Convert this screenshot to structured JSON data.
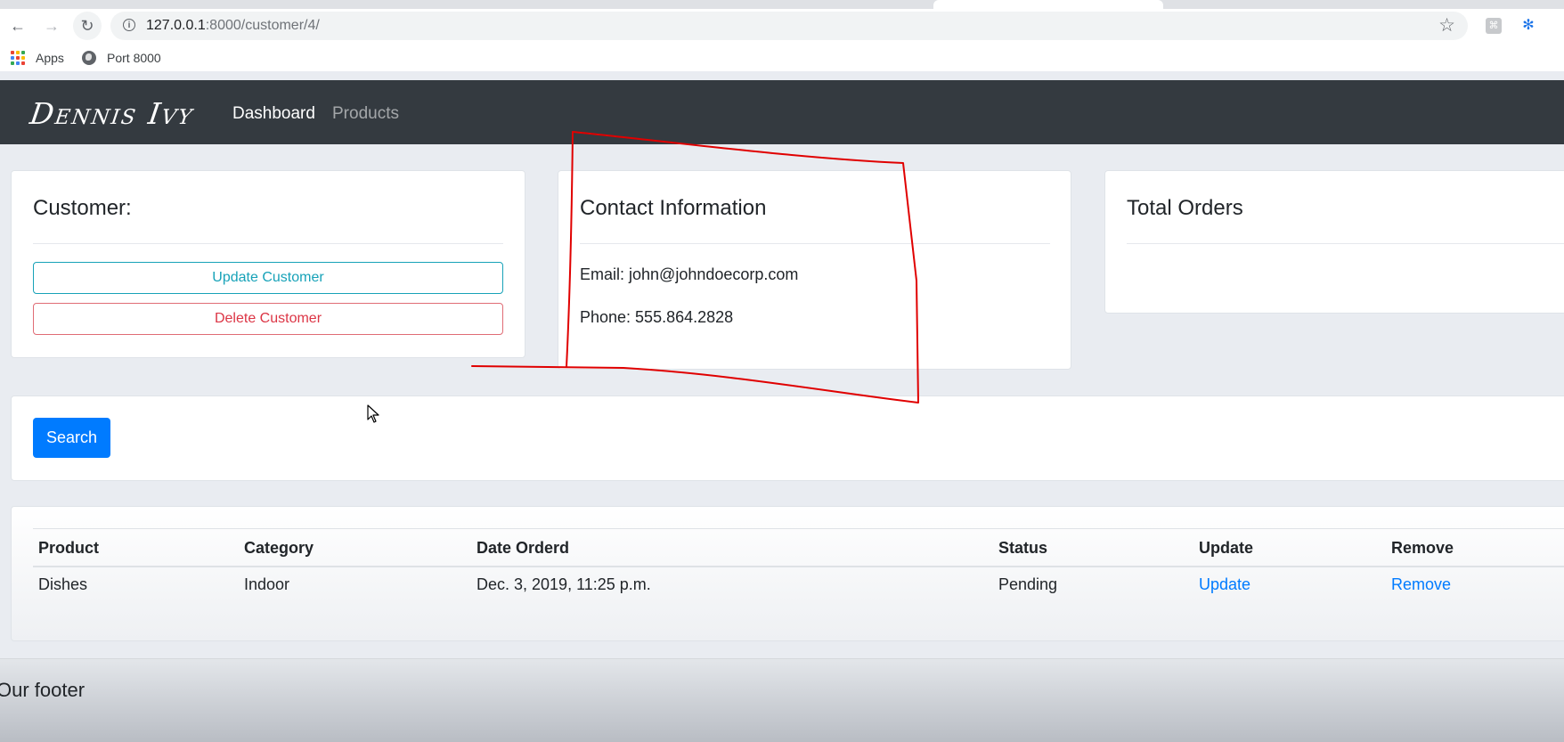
{
  "browser": {
    "url_host": "127.0.0.1",
    "url_path": ":8000/customer/4/",
    "bookmarks": [
      {
        "label": "Apps",
        "icon": "apps-grid-icon"
      },
      {
        "label": "Port 8000",
        "icon": "globe-icon"
      }
    ]
  },
  "navbar": {
    "brand": "Dennis Ivy",
    "links": [
      "Dashboard",
      "Products"
    ]
  },
  "customer_card": {
    "title": "Customer:",
    "update_label": "Update Customer",
    "delete_label": "Delete Customer"
  },
  "contact_card": {
    "title": "Contact Information",
    "email": "Email: john@johndoecorp.com",
    "phone": "Phone: 555.864.2828"
  },
  "orders_card": {
    "title": "Total Orders"
  },
  "search": {
    "button_label": "Search"
  },
  "orders_table": {
    "headers": [
      "Product",
      "Category",
      "Date Orderd",
      "Status",
      "Update",
      "Remove"
    ],
    "rows": [
      [
        "Dishes",
        "Indoor",
        "Dec. 3, 2019, 11:25 p.m.",
        "Pending",
        "Update",
        "Remove"
      ]
    ]
  },
  "footer": {
    "text": "Our footer"
  },
  "colors": {
    "navbar": "#343a40",
    "primary": "#007bff",
    "info": "#17a2b8",
    "danger": "#dc3545",
    "annotation": "#e00000"
  }
}
